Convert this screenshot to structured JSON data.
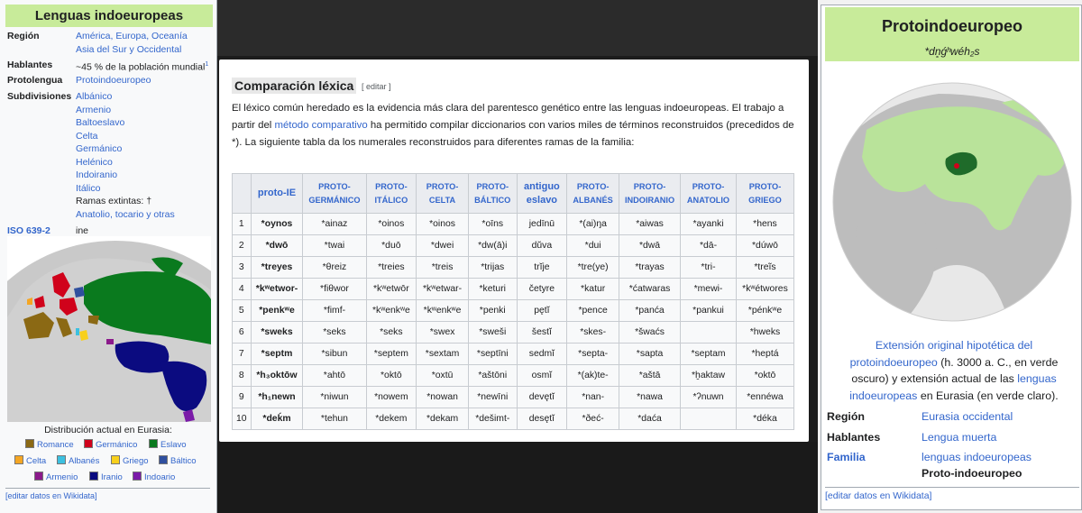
{
  "left": {
    "title": "Lenguas indoeuropeas",
    "region_key": "Región",
    "region_val": [
      "América, Europa, Oceanía",
      "Asia del Sur y Occidental"
    ],
    "speakers_key": "Hablantes",
    "speakers_val": "~45 % de la población mundial",
    "speakers_ref": "1",
    "proto_key": "Protolengua",
    "proto_val": "Protoindoeuropeo",
    "subdiv_key": "Subdivisiones",
    "subdiv_items": [
      "Albánico",
      "Armenio",
      "Baltoeslavo",
      "Celta",
      "Germánico",
      "Helénico",
      "Indoiranio",
      "Itálico"
    ],
    "extinct_label": "Ramas extintas: †",
    "extinct_items": "Anatolio, tocario y otras",
    "iso_key": "ISO 639-2",
    "iso_val": "ine",
    "map_caption": "Distribución actual en Eurasia:",
    "legend": [
      {
        "label": "Romance",
        "color": "#8b6914"
      },
      {
        "label": "Germánico",
        "color": "#d0021b"
      },
      {
        "label": "Eslavo",
        "color": "#0a7a1e"
      },
      {
        "label": "Celta",
        "color": "#f5a623"
      },
      {
        "label": "Albanés",
        "color": "#3cc0e0"
      },
      {
        "label": "Griego",
        "color": "#f8d01c"
      },
      {
        "label": "Báltico",
        "color": "#2f4f9e"
      },
      {
        "label": "Armenio",
        "color": "#8b1a8b"
      },
      {
        "label": "Iranio",
        "color": "#0b0b80"
      },
      {
        "label": "Indoario",
        "color": "#7a1aa8"
      }
    ],
    "wikidata": "[editar datos en Wikidata]"
  },
  "middle": {
    "heading": "Comparación léxica",
    "edit": "[ editar ]",
    "paragraph_1": "El léxico común heredado es la evidencia más clara del parentesco genético entre las lenguas indoeuropeas. El trabajo a partir del ",
    "paragraph_link": "método comparativo",
    "paragraph_2": " ha permitido compilar diccionarios con varios miles de términos reconstruidos (precedidos de *). La siguiente tabla da los numerales reconstruidos para diferentes ramas de la familia:",
    "headers": [
      "",
      "proto-IE",
      "PROTO-GERMÁNICO",
      "PROTO-ITÁLICO",
      "PROTO-CELTA",
      "PROTO-BÁLTICO",
      "antiguo eslavo",
      "PROTO-ALBANÉS",
      "PROTO-INDOIRANIO",
      "PROTO-ANATOLIO",
      "PROTO-GRIEGO"
    ],
    "rows": [
      [
        "1",
        "*oynos",
        "*ainaz",
        "*oinos",
        "*oinos",
        "*oīns",
        "jedīnū",
        "*(ai)ŋa",
        "*aiwas",
        "*ayanki",
        "*hens"
      ],
      [
        "2",
        "*dwō",
        "*twai",
        "*duō",
        "*dwei",
        "*dw(ā)i",
        "dŭva",
        "*dui",
        "*dwā",
        "*dā-",
        "*dúwō"
      ],
      [
        "3",
        "*treyes",
        "*θreiz",
        "*treies",
        "*treis",
        "*trijas",
        "trĭje",
        "*tre(ye)",
        "*trayas",
        "*tri-",
        "*treĩs"
      ],
      [
        "4",
        "*kʷetwor-",
        "*fiθwor",
        "*kʷetwōr",
        "*kʷetwar-",
        "*keturi",
        "četyre",
        "*katur",
        "*ćatwaras",
        "*mewi-",
        "*kʷétwores"
      ],
      [
        "5",
        "*penkʷe",
        "*fimf-",
        "*kʷenkʷe",
        "*kʷenkʷe",
        "*penki",
        "pętĭ",
        "*pence",
        "*panća",
        "*pankui",
        "*pénkʷe"
      ],
      [
        "6",
        "*sweks",
        "*seks",
        "*seks",
        "*swex",
        "*sweši",
        "šestĭ",
        "*skes-",
        "*šwaćs",
        "",
        "*hweks"
      ],
      [
        "7",
        "*septm",
        "*sibun",
        "*septem",
        "*sextam",
        "*septīni",
        "sedmĭ",
        "*septa-",
        "*sapta",
        "*septam",
        "*heptá"
      ],
      [
        "8",
        "*h₃oktōw",
        "*ahtō",
        "*oktō",
        "*oxtū",
        "*aštōni",
        "osmĭ",
        "*(ak)te-",
        "*aštā",
        "*ḫaktaw",
        "*oktō"
      ],
      [
        "9",
        "*h₁newn",
        "*niwun",
        "*nowem",
        "*nowan",
        "*newīni",
        "devętĭ",
        "*nan-",
        "*nawa",
        "*ʔnuwn",
        "*ennéwa"
      ],
      [
        "10",
        "*deḱm",
        "*tehun",
        "*dekem",
        "*dekam",
        "*dešimt-",
        "desętĭ",
        "*ðeć-",
        "*daća",
        "",
        "*déka"
      ]
    ]
  },
  "right": {
    "title": "Protoindoeuropeo",
    "subtitle": "*dn̥ǵʰwéh₂s",
    "caption_link1": "Extensión original hipotética del protoindoeuropeo",
    "caption_mid": " (h. 3000 a. C., en verde oscuro) y extensión actual de las ",
    "caption_link2": "lenguas indoeuropeas",
    "caption_end": " en Eurasia (en verde claro).",
    "region_key": "Región",
    "region_val": "Eurasia occidental",
    "speakers_key": "Hablantes",
    "speakers_val": "Lengua muerta",
    "family_key": "Familia",
    "family_val": "lenguas indoeuropeas",
    "family_sub": "Proto-indoeuropeo",
    "wikidata": "[editar datos en Wikidata]"
  }
}
